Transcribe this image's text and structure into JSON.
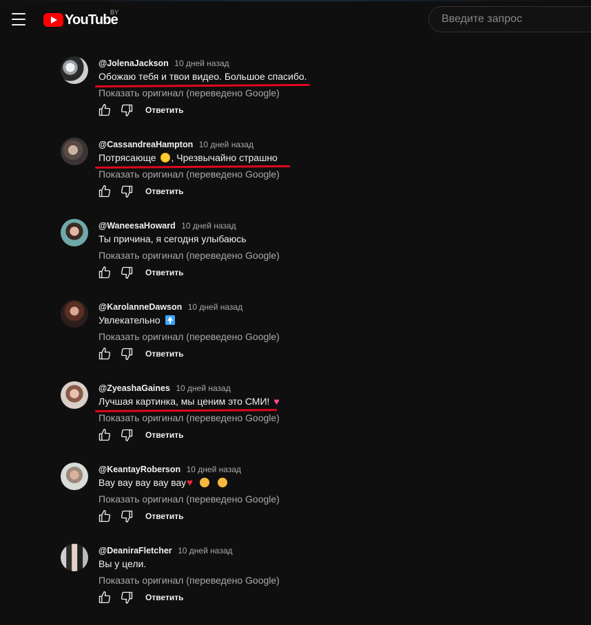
{
  "header": {
    "logo_text": "YouTube",
    "region": "BY",
    "search_placeholder": "Введите запрос"
  },
  "icons": {
    "menu": "hamburger-menu-icon",
    "like": "thumbs-up-icon",
    "dislike": "thumbs-down-icon"
  },
  "colors": {
    "background": "#0f0f0f",
    "brand_red": "#ff0000",
    "underline_red": "#e0081f",
    "secondary_text": "#aaaaaa"
  },
  "comments": [
    {
      "author": "@JolenaJackson",
      "time": "10 дней назад",
      "text": "Обожаю тебя и твои видео. Большое спасибо.",
      "translate": "Показать оригинал (переведено Google)",
      "reply": "Ответить"
    },
    {
      "author": "@CassandreaHampton",
      "time": "10 дней назад",
      "text_before": "Потрясающе",
      "text_after": ", Чрезвычайно страшно",
      "translate": "Показать оригинал (переведено Google)",
      "reply": "Ответить"
    },
    {
      "author": "@WaneesaHoward",
      "time": "10 дней назад",
      "text": "Ты причина, я сегодня улыбаюсь",
      "translate": "Показать оригинал (переведено Google)",
      "reply": "Ответить"
    },
    {
      "author": "@KarolanneDawson",
      "time": "10 дней назад",
      "text": "Увлекательно",
      "translate": "Показать оригинал (переведено Google)",
      "reply": "Ответить"
    },
    {
      "author": "@ZyeashaGaines",
      "time": "10 дней назад",
      "text": "Лучшая картинка, мы ценим это СМИ!",
      "translate": "Показать оригинал (переведено Google)",
      "reply": "Ответить"
    },
    {
      "author": "@KeantayRoberson",
      "time": "10 дней назад",
      "text": "Вау вау вау вау вау",
      "translate": "Показать оригинал (переведено Google)",
      "reply": "Ответить"
    },
    {
      "author": "@DeaniraFletcher",
      "time": "10 дней назад",
      "text": "Вы у цели.",
      "translate": "Показать оригинал (переведено Google)",
      "reply": "Ответить"
    }
  ]
}
